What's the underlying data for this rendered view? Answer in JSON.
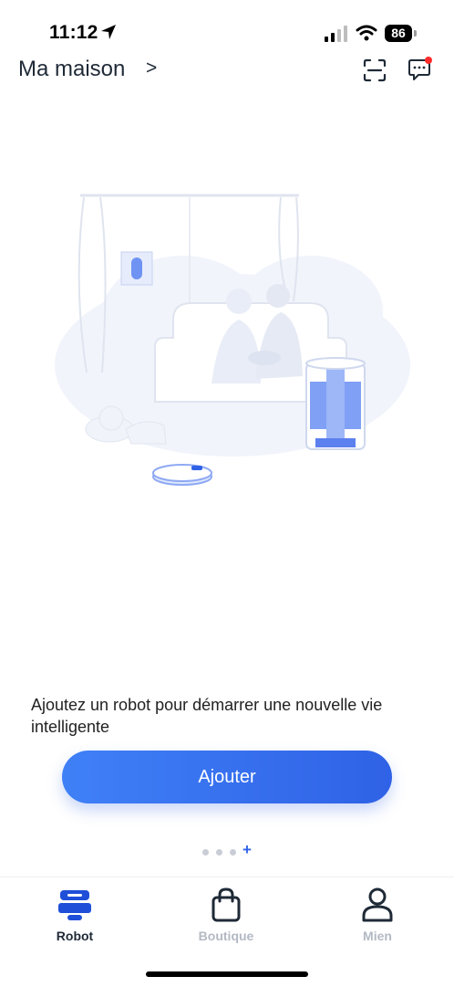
{
  "status_bar": {
    "time": "11:12",
    "battery": "86",
    "icons": [
      "location-arrow-icon",
      "cellular-signal-icon",
      "wifi-icon",
      "battery-icon"
    ]
  },
  "header": {
    "title": "Ma maison",
    "chevron": ">",
    "icons": [
      "scan-icon",
      "chat-icon"
    ],
    "notification_dot_color": "#ff2a2a"
  },
  "illustration": {
    "icon": "living-room-illustration",
    "accent_color": "#6f93f3"
  },
  "promo": {
    "text": "Ajoutez un robot pour démarrer une nouvelle vie intelligente"
  },
  "actions": {
    "add_label": "Ajouter",
    "button_colors": [
      "#3f80f7",
      "#2f62e6"
    ]
  },
  "pager": {
    "dots": 3,
    "plus": "+"
  },
  "tab_bar": {
    "tabs": [
      {
        "label": "Robot",
        "icon": "robot-icon",
        "active": true
      },
      {
        "label": "Boutique",
        "icon": "shopping-bag-icon",
        "active": false
      },
      {
        "label": "Mien",
        "icon": "person-icon",
        "active": false
      }
    ],
    "active_color": "#1f2a37",
    "inactive_color": "#b3b9c4"
  }
}
